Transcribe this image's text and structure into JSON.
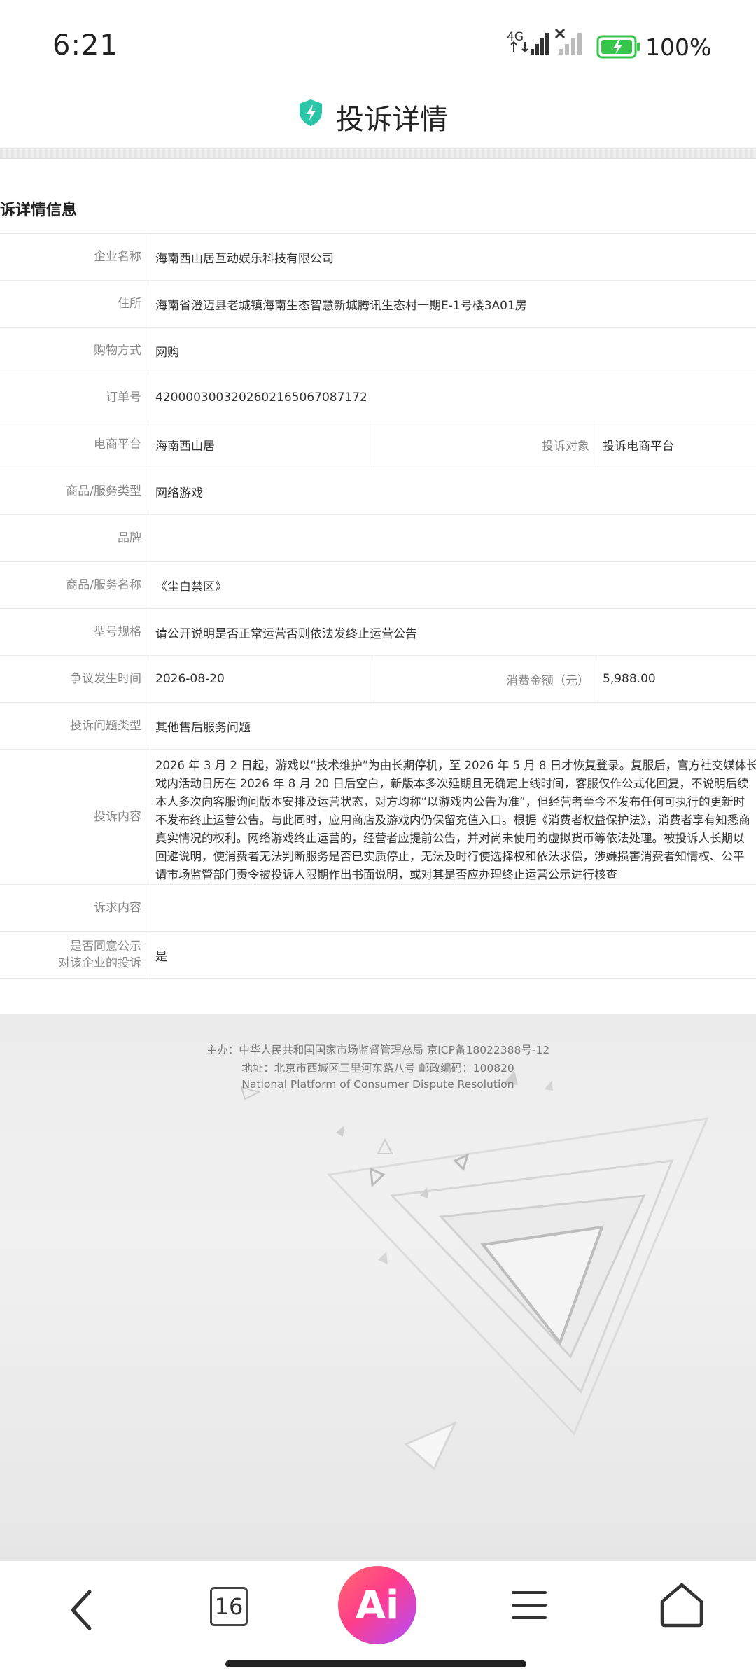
{
  "status_bar": {
    "time": "6:21",
    "network": "4G",
    "battery": "100%"
  },
  "header": {
    "title": "投诉详情"
  },
  "section": {
    "title": "诉详情信息"
  },
  "details": {
    "company_name": {
      "label": "企业名称",
      "value": "海南西山居互动娱乐科技有限公司"
    },
    "address": {
      "label": "住所",
      "value": "海南省澄迈县老城镇海南生态智慧新城腾讯生态村一期E-1号楼3A01房"
    },
    "purchase_method": {
      "label": "购物方式",
      "value": "网购"
    },
    "order_no": {
      "label": "订单号",
      "value": "4200003003202602165067087172"
    },
    "platform": {
      "label": "电商平台",
      "value": "海南西山居"
    },
    "complaint_target": {
      "label": "投诉对象",
      "value": "投诉电商平台"
    },
    "goods_type": {
      "label": "商品/服务类型",
      "value": "网络游戏"
    },
    "brand": {
      "label": "品牌",
      "value": ""
    },
    "goods_name": {
      "label": "商品/服务名称",
      "value": "《尘白禁区》"
    },
    "model": {
      "label": "型号规格",
      "value": "请公开说明是否正常运营否则依法发终止运营公告"
    },
    "dispute_time": {
      "label": "争议发生时间",
      "value": "2026-08-20"
    },
    "amount": {
      "label": "消费金额（元）",
      "value": "5,988.00"
    },
    "issue_type": {
      "label": "投诉问题类型",
      "value": "其他售后服务问题"
    },
    "content": {
      "label": "投诉内容",
      "lines": [
        "2026 年 3 月 2 日起，游戏以“技术维护”为由长期停机，至 2026 年 5 月 8 日才恢复登录。复服后，官方社交媒体长",
        "戏内活动日历在 2026 年 8 月 20 日后空白，新版本多次延期且无确定上线时间，客服仅作公式化回复，不说明后续",
        "本人多次向客服询问版本安排及运营状态，对方均称“以游戏内公告为准”，但经营者至今不发布任何可执行的更新时",
        "不发布终止运营公告。与此同时，应用商店及游戏内仍保留充值入口。根据《消费者权益保护法》，消费者享有知悉商",
        "真实情况的权利。网络游戏终止运营的，经营者应提前公告，并对尚未使用的虚拟货币等依法处理。被投诉人长期以",
        "回避说明，使消费者无法判断服务是否已实质停止，无法及时行使选择权和依法求偿，涉嫌损害消费者知情权、公平",
        "请市场监管部门责令被投诉人限期作出书面说明，或对其是否应办理终止运营公示进行核查"
      ]
    },
    "request": {
      "label": "诉求内容",
      "value": ""
    },
    "publicity": {
      "label_line1": "是否同意公示",
      "label_line2": "对该企业的投诉",
      "value": "是"
    }
  },
  "footer": {
    "line1": "主办：中华人民共和国国家市场监督管理总局 京ICP备18022388号-12",
    "line2": "地址：北京市西城区三里河东路八号 邮政编码：100820",
    "line3": "National Platform of Consumer Dispute Resolution"
  },
  "nav": {
    "tab_count": "16",
    "ai_label": "Ai"
  },
  "colors": {
    "shield": "#2bc6a8",
    "battery": "#35c64a",
    "ai_gradient_start": "#ff6b6b",
    "ai_gradient_end": "#b04dff"
  }
}
